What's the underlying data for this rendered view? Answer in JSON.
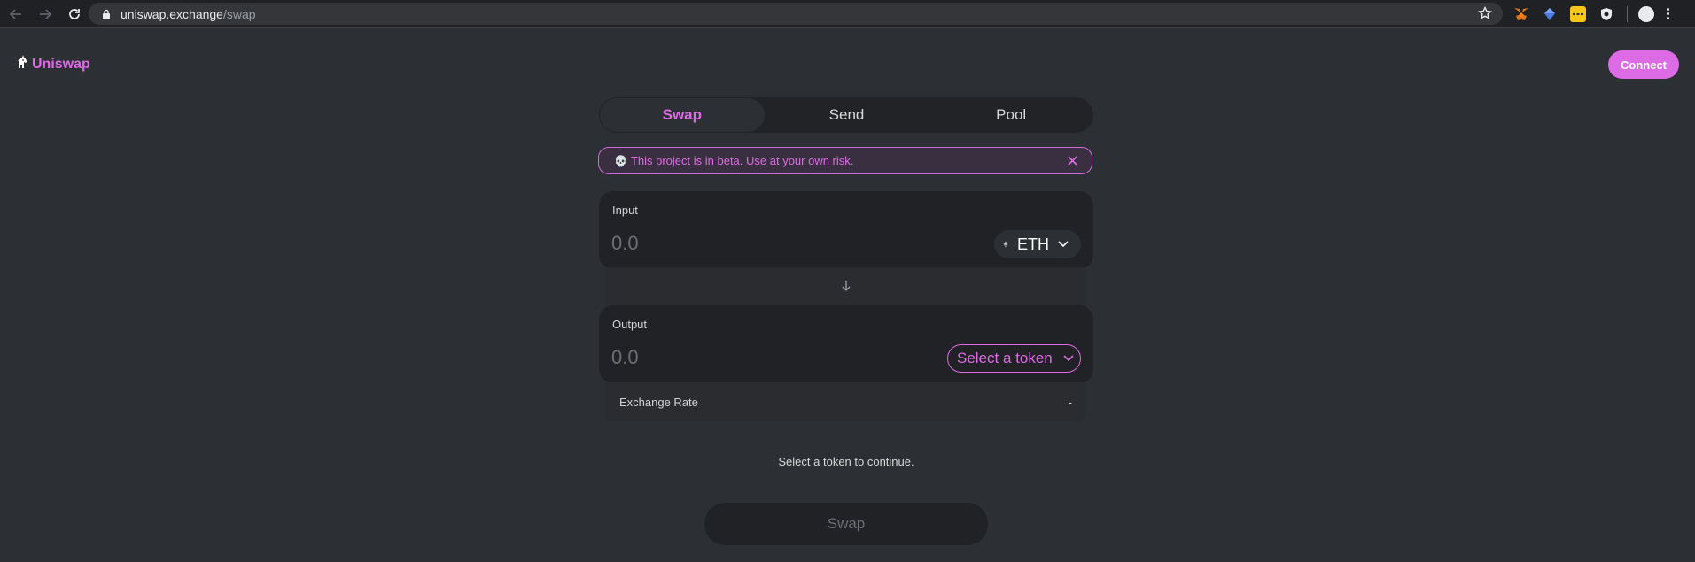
{
  "browser": {
    "url_host": "uniswap.exchange",
    "url_path": "/swap",
    "icons": [
      "back-arrow-icon",
      "forward-arrow-icon",
      "reload-icon",
      "lock-icon",
      "bookmark-star-icon",
      "metamask-extension-icon",
      "extension-icon",
      "extension-icon",
      "extension-icon",
      "profile-avatar-icon",
      "menu-kebab-icon"
    ]
  },
  "app": {
    "logo_text": "Uniswap",
    "connect_label": "Connect",
    "accent_color": "#dc6be5",
    "tabs": [
      {
        "label": "Swap",
        "active": true
      },
      {
        "label": "Send",
        "active": false
      },
      {
        "label": "Pool",
        "active": false
      }
    ],
    "beta_notice": {
      "icon": "💀",
      "text": "This project is in beta. Use at your own risk."
    },
    "input": {
      "label": "Input",
      "placeholder": "0.0",
      "token": "ETH"
    },
    "output": {
      "label": "Output",
      "placeholder": "0.0",
      "token_select_label": "Select a token"
    },
    "exchange_rate": {
      "label": "Exchange Rate",
      "value": "-"
    },
    "hint": "Select a token to continue.",
    "swap_button_label": "Swap"
  }
}
